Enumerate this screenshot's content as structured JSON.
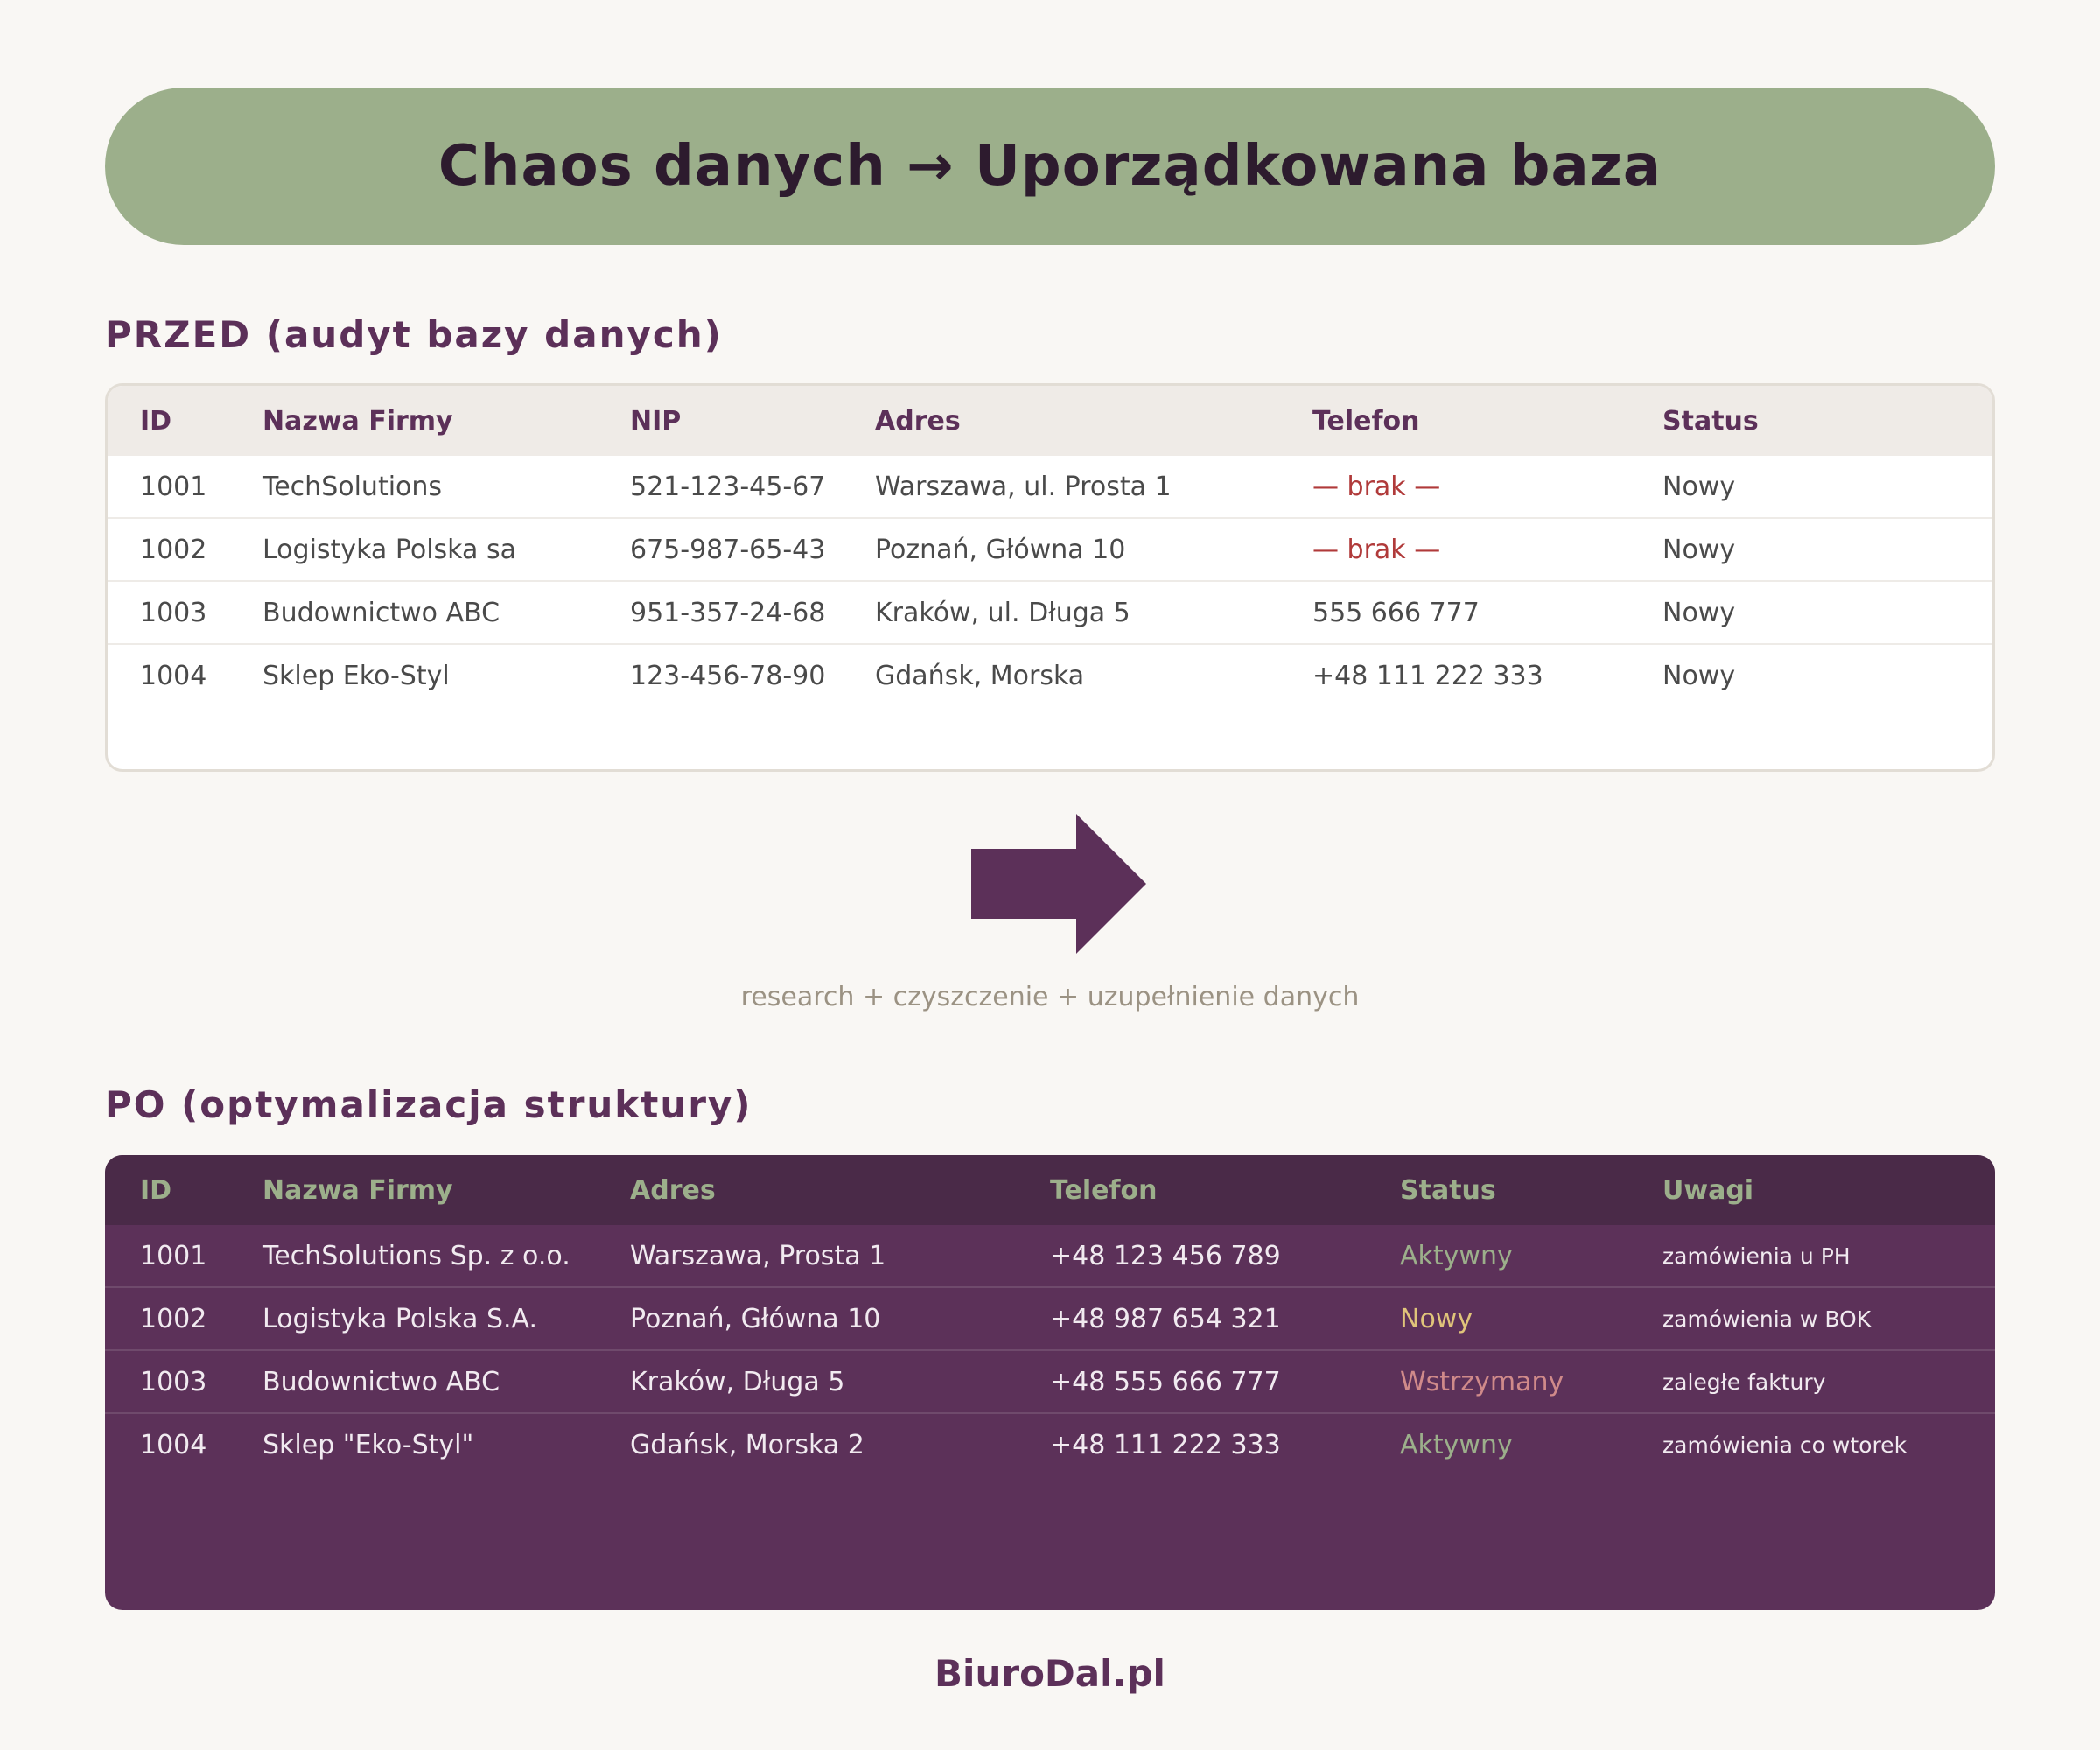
{
  "banner": {
    "title": "Chaos danych → Uporządkowana baza"
  },
  "before": {
    "title": "PRZED (audyt bazy danych)",
    "headers": [
      "ID",
      "Nazwa Firmy",
      "NIP",
      "Adres",
      "Telefon",
      "Status"
    ],
    "rows": [
      [
        "1001",
        "TechSolutions",
        "521-123-45-67",
        "Warszawa, ul. Prosta 1",
        "— brak —",
        "Nowy"
      ],
      [
        "1002",
        "Logistyka Polska sa",
        "675-987-65-43",
        "Poznań, Główna 10",
        "— brak —",
        "Nowy"
      ],
      [
        "1003",
        "Budownictwo ABC",
        "951-357-24-68",
        "Kraków, ul. Długa 5",
        "555 666 777",
        "Nowy"
      ],
      [
        "1004",
        "Sklep Eko-Styl",
        "123-456-78-90",
        "Gdańsk, Morska",
        "+48 111 222 333",
        "Nowy"
      ]
    ]
  },
  "transition": {
    "caption": "research + czyszczenie + uzupełnienie danych",
    "arrow_icon": "arrow-right-icon",
    "arrow_color": "#5c3059"
  },
  "after": {
    "title": "PO (optymalizacja struktury)",
    "headers": [
      "ID",
      "Nazwa Firmy",
      "Adres",
      "Telefon",
      "Status",
      "Uwagi"
    ],
    "rows": [
      [
        "1001",
        "TechSolutions Sp. z o.o.",
        "Warszawa, Prosta 1",
        "+48 123 456 789",
        "Aktywny",
        "zamówienia u PH"
      ],
      [
        "1002",
        "Logistyka Polska S.A.",
        "Poznań, Główna 10",
        "+48 987 654 321",
        "Nowy",
        "zamówienia w BOK"
      ],
      [
        "1003",
        "Budownictwo ABC",
        "Kraków, Długa 5",
        "+48 555 666 777",
        "Wstrzymany",
        "zaległe faktury"
      ],
      [
        "1004",
        "Sklep \"Eko-Styl\"",
        "Gdańsk, Morska 2",
        "+48 111 222 333",
        "Aktywny",
        "zamówienia co wtorek"
      ]
    ],
    "status_colors": {
      "Aktywny": "#9caf8b",
      "Nowy": "#e0c47a",
      "Wstrzymany": "#d08a8a"
    }
  },
  "colors": {
    "background": "#f9f7f4",
    "banner": "#9caf8b",
    "accent": "#5c3059",
    "missing": "#b03a3a"
  },
  "footer": {
    "brand": "BiuroDal.pl"
  }
}
